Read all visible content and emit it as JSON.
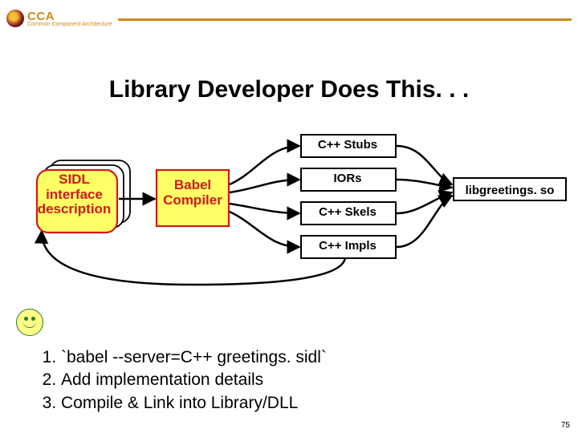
{
  "brand": {
    "abbr": "CCA",
    "full": "Common Component Architecture"
  },
  "title": "Library Developer Does This. . .",
  "diagram": {
    "sidl": "SIDL\ninterface\ndescription",
    "babel": "Babel\nCompiler",
    "out1": "C++ Stubs",
    "out2": "IORs",
    "out3": "C++ Skels",
    "out4": "C++ Impls",
    "lib": "libgreetings. so"
  },
  "steps": [
    "`babel --server=C++ greetings. sidl`",
    "Add implementation details",
    "Compile & Link into Library/DLL"
  ],
  "pagenum": "75"
}
